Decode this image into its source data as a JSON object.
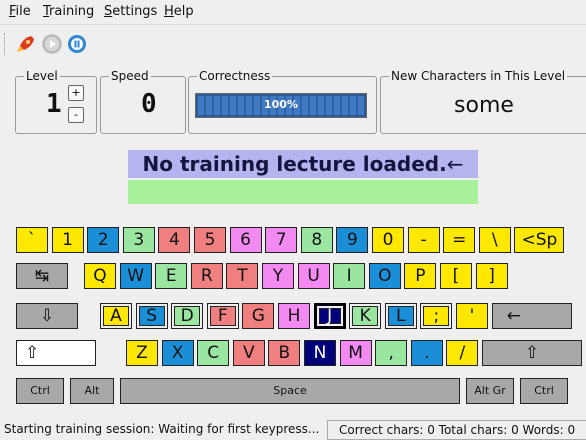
{
  "menu": [
    {
      "u": "F",
      "rest": "ile"
    },
    {
      "u": "T",
      "rest": "raining"
    },
    {
      "u": "S",
      "rest": "ettings"
    },
    {
      "u": "H",
      "rest": "elp"
    }
  ],
  "toolbar": {
    "icons": [
      "rocket-icon",
      "play-icon",
      "pause-icon"
    ]
  },
  "level": {
    "title": "Level",
    "value": "1",
    "inc": "+",
    "dec": "-"
  },
  "speed": {
    "title": "Speed",
    "value": "0"
  },
  "correctness": {
    "title": "Correctness",
    "percent": 100,
    "label": "100%"
  },
  "new_chars": {
    "title": "New Characters in This Level",
    "value": "some"
  },
  "lecture": {
    "text": "No training lecture loaded.",
    "enter_glyph": "←"
  },
  "keyboard": {
    "row1": [
      "`",
      "1",
      "2",
      "3",
      "4",
      "5",
      "6",
      "7",
      "8",
      "9",
      "0",
      "-",
      "=",
      "\\",
      "<Sp"
    ],
    "row2": [
      "↹",
      "Q",
      "W",
      "E",
      "R",
      "T",
      "Y",
      "U",
      "I",
      "O",
      "P",
      "[",
      "]"
    ],
    "row3": [
      "⇩",
      "A",
      "S",
      "D",
      "F",
      "G",
      "H",
      "J",
      "K",
      "L",
      ";",
      "'",
      "←"
    ],
    "row4": [
      "⇧",
      "Z",
      "X",
      "C",
      "V",
      "B",
      "N",
      "M",
      ",",
      ".",
      "/",
      "⇧"
    ],
    "row5": [
      "Ctrl",
      "Alt",
      "Space",
      "Alt Gr",
      "Ctrl"
    ],
    "colors": {
      "yellow": "#ffe800",
      "blue": "#1a8fd8",
      "green": "#9ae6a0",
      "red": "#f08080",
      "pink": "#f28af2",
      "purple": "#d8a8f8",
      "navy": "#00007a",
      "gray": "#a8a8a8",
      "white": "#ffffff"
    }
  },
  "status": {
    "message": "Starting training session: Waiting for first keypress...",
    "stats": "Correct chars: 0  Total chars: 0  Words: 0"
  }
}
